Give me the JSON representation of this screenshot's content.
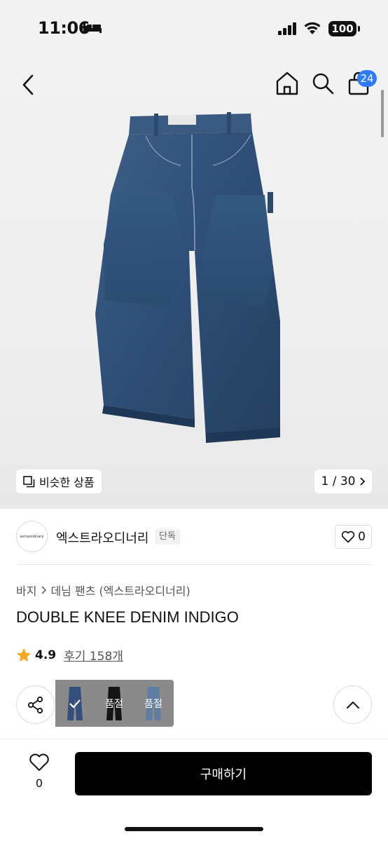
{
  "status_bar": {
    "time": "11:06",
    "battery": "100"
  },
  "nav": {
    "cart_count": "24"
  },
  "gallery": {
    "similar_label": "비슷한 상품",
    "counter": "1 / 30"
  },
  "brand": {
    "name": "엑스트라오디너리",
    "tag": "단독",
    "logo_text": "extraordinary",
    "like_count": "0"
  },
  "breadcrumb": {
    "category": "바지",
    "subcategory": "데님 팬츠 (엑스트라오디너리)"
  },
  "product": {
    "title": "DOUBLE KNEE DENIM INDIGO"
  },
  "rating": {
    "score": "4.9",
    "reviews": "후기 158개"
  },
  "colors": [
    {
      "name": "indigo",
      "selected": true,
      "label": ""
    },
    {
      "name": "black",
      "selected": false,
      "label": "품절"
    },
    {
      "name": "light-blue",
      "selected": false,
      "label": "품절"
    }
  ],
  "bottom": {
    "wish_count": "0",
    "buy_label": "구매하기"
  },
  "accent": {
    "badge": "#2e7cf6",
    "buy_button": "#000000",
    "star": "#f5a623"
  }
}
